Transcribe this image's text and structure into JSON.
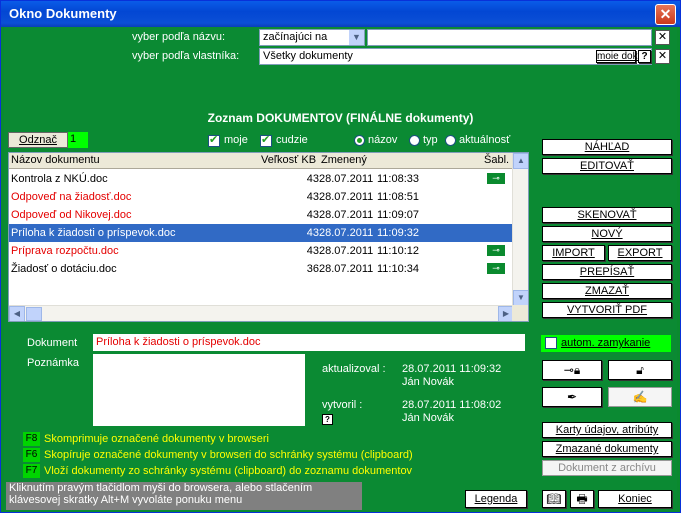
{
  "window": {
    "title": "Okno Dokumenty",
    "close": "✕"
  },
  "filter": {
    "by_name_label": "vyber podľa názvu:",
    "by_name_mode": "začínajúci na",
    "by_name_value": "",
    "by_owner_label": "vyber podľa vlastníka:",
    "by_owner_value": "Všetky dokumenty",
    "my_docs_button": "moie dok.",
    "help_button": "?"
  },
  "heading": "Zoznam DOKUMENTOV (FINÁLNE dokumenty)",
  "selection": {
    "unmark_button": "Odznač",
    "count": "1"
  },
  "checkboxes": [
    {
      "label": "moje",
      "checked": true
    },
    {
      "label": "cudzie",
      "checked": true
    }
  ],
  "sort": [
    {
      "label": "názov",
      "checked": true
    },
    {
      "label": "typ",
      "checked": false
    },
    {
      "label": "aktuálnosť",
      "checked": false
    }
  ],
  "table": {
    "columns": [
      "Názov dokumentu",
      "Veľkosť KB",
      "Zmenený",
      "Šabl."
    ],
    "rows": [
      {
        "name": "Kontrola z NKÚ.doc",
        "size": "43",
        "date": "28.07.2011",
        "time": "11:08:33",
        "red": false,
        "selected": false,
        "key": true
      },
      {
        "name": "Odpoveď na žiadosť.doc",
        "size": "43",
        "date": "28.07.2011",
        "time": "11:08:51",
        "red": true,
        "selected": false,
        "key": false
      },
      {
        "name": "Odpoveď od Nikovej.doc",
        "size": "43",
        "date": "28.07.2011",
        "time": "11:09:07",
        "red": true,
        "selected": false,
        "key": false
      },
      {
        "name": "Príloha k žiadosti o príspevok.doc",
        "size": "43",
        "date": "28.07.2011",
        "time": "11:09:32",
        "red": false,
        "selected": true,
        "key": false
      },
      {
        "name": "Príprava rozpočtu.doc",
        "size": "43",
        "date": "28.07.2011",
        "time": "11:10:12",
        "red": true,
        "selected": false,
        "key": true
      },
      {
        "name": "Žiadosť o dotáciu.doc",
        "size": "36",
        "date": "28.07.2011",
        "time": "11:10:34",
        "red": false,
        "selected": false,
        "key": true
      }
    ]
  },
  "right_buttons": {
    "nahlad": "NÁHĽAD",
    "editovat": "EDITOVAŤ",
    "skenovat": "SKENOVAŤ",
    "novy": "NOVÝ",
    "import": "IMPORT",
    "export": "EXPORT",
    "prepisat": "PREPÍSAŤ",
    "zmazat": "ZMAZAŤ",
    "pdf": "VYTVORIŤ PDF",
    "autom": "autom. zamykanie",
    "karty": "Karty údajov, atribúty",
    "zmazane": "Zmazané dokumenty",
    "z_archivu": "Dokument z archívu"
  },
  "detail": {
    "dokument_label": "Dokument",
    "dokument_value": "Príloha k žiadosti o príspevok.doc",
    "poznamka_label": "Poznámka",
    "updated_label": "aktualizoval :",
    "updated_date": "28.07.2011 11:09:32",
    "updated_by": "Ján Novák",
    "created_label": "vytvoril :",
    "created_date": "28.07.2011 11:08:02",
    "created_by": "Ján Novák"
  },
  "shortcuts": [
    {
      "key": "F8",
      "text": "Skomprimuje označené dokumenty v browseri"
    },
    {
      "key": "F6",
      "text": "Skopíruje označené dokumenty v browseri do schránky systému (clipboard)"
    },
    {
      "key": "F7",
      "text": "Vloží dokumenty zo schránky systému (clipboard) do zoznamu dokumentov"
    }
  ],
  "status": {
    "line1": "Kliknutím pravým tlačidlom myši do browsera, alebo stlačením",
    "line2": "klávesovej skratky Alt+M vyvoláte ponuku menu"
  },
  "footer": {
    "legenda": "Legenda",
    "koniec": "Koniec"
  },
  "colors": {
    "panel": "#0b8a33",
    "title": "#0347d3",
    "accent_red": "#e40000",
    "shortcut_text": "#ffff00",
    "selection": "#316ac5"
  }
}
